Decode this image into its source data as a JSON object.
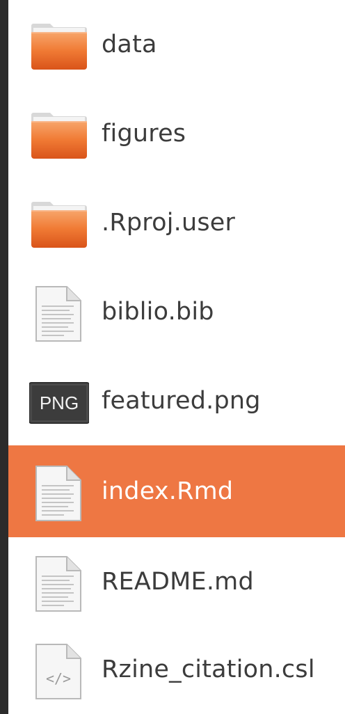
{
  "file_list": {
    "items": [
      {
        "name": "data",
        "icon": "folder-icon"
      },
      {
        "name": "figures",
        "icon": "folder-icon"
      },
      {
        "name": ".Rproj.user",
        "icon": "folder-icon"
      },
      {
        "name": "biblio.bib",
        "icon": "text-file-icon"
      },
      {
        "name": "featured.png",
        "icon": "png-image-icon",
        "icon_text": "PNG"
      },
      {
        "name": "index.Rmd",
        "icon": "text-file-icon",
        "selected": true
      },
      {
        "name": "README.md",
        "icon": "text-file-icon"
      },
      {
        "name": "Rzine_citation.csl",
        "icon": "code-file-icon",
        "icon_text": "</>"
      }
    ]
  },
  "colors": {
    "selection": "#ee7743",
    "folder": "#f07a3a",
    "background": "#2b2b2b"
  }
}
